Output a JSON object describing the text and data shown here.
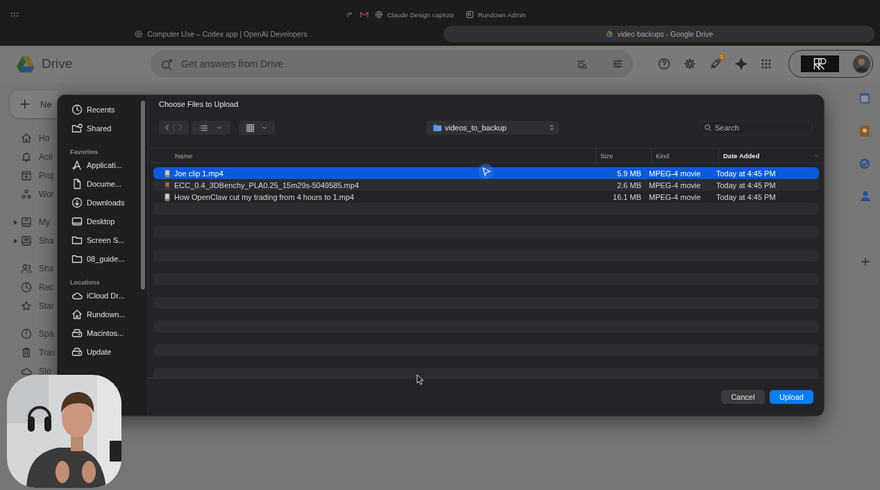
{
  "browser": {
    "bookmarks": [
      {
        "label": "Claude Design capture"
      },
      {
        "label": "Rundown Admin"
      }
    ],
    "tabs": [
      {
        "title": "Computer Use – Codex app | OpenAI Developers",
        "selected": false
      },
      {
        "title": "video backups - Google Drive",
        "selected": true
      }
    ]
  },
  "drive": {
    "app_name": "Drive",
    "search": {
      "placeholder": "Get answers from Drive"
    },
    "notification_count": "1",
    "new_button": "Ne",
    "nav": [
      {
        "label": "Ho",
        "kind": "home",
        "expandable": false
      },
      {
        "label": "Acti",
        "kind": "bell",
        "expandable": false
      },
      {
        "label": "Proj",
        "kind": "project",
        "expandable": false
      },
      {
        "label": "Wor",
        "kind": "workspace",
        "expandable": false
      },
      {
        "label": "My",
        "kind": "drive",
        "expandable": true
      },
      {
        "label": "Sha",
        "kind": "shared-drive",
        "expandable": true
      },
      {
        "label": "Sha",
        "kind": "people",
        "expandable": false
      },
      {
        "label": "Rec",
        "kind": "clock",
        "expandable": false
      },
      {
        "label": "Star",
        "kind": "star",
        "expandable": false
      },
      {
        "label": "Spa",
        "kind": "alert",
        "expandable": false
      },
      {
        "label": "Tras",
        "kind": "trash",
        "expandable": false
      },
      {
        "label": "Sto",
        "kind": "cloud",
        "expandable": false
      }
    ]
  },
  "dialog": {
    "title": "Choose Files to Upload",
    "folder": "videos_to_backup",
    "search": {
      "placeholder": "Search"
    },
    "sidebar": [
      {
        "items": [
          {
            "label": "Recents",
            "kind": "clock"
          },
          {
            "label": "Shared",
            "kind": "shared-folder"
          }
        ]
      },
      {
        "heading": "Favorites",
        "items": [
          {
            "label": "Applicati...",
            "kind": "apps"
          },
          {
            "label": "Docume...",
            "kind": "document"
          },
          {
            "label": "Downloads",
            "kind": "download"
          },
          {
            "label": "Desktop",
            "kind": "desktop"
          },
          {
            "label": "Screen S...",
            "kind": "folder"
          },
          {
            "label": "08_guide...",
            "kind": "folder"
          }
        ]
      },
      {
        "heading": "Locations",
        "items": [
          {
            "label": "iCloud Dr...",
            "kind": "cloud"
          },
          {
            "label": "Rundown...",
            "kind": "home"
          },
          {
            "label": "Macintos...",
            "kind": "disk"
          },
          {
            "label": "Update",
            "kind": "disk"
          }
        ]
      }
    ],
    "columns": [
      {
        "label": "Name",
        "sorted": false
      },
      {
        "label": "Size",
        "sorted": false
      },
      {
        "label": "Kind",
        "sorted": false
      },
      {
        "label": "Date Added",
        "sorted": true
      }
    ],
    "rows": [
      {
        "name": "Joe clip 1.mp4",
        "size": "5.9 MB",
        "kind": "MPEG-4 movie",
        "date": "Today at 4:45 PM",
        "selected": true
      },
      {
        "name": "ECC_0.4_3DBenchy_PLA0.25_15m29s-5049585.mp4",
        "size": "2.6 MB",
        "kind": "MPEG-4 movie",
        "date": "Today at 4:45 PM",
        "selected": false
      },
      {
        "name": "How OpenClaw cut my trading from 4 hours to 1.mp4",
        "size": "16.1 MB",
        "kind": "MPEG-4 movie",
        "date": "Today at 4:45 PM",
        "selected": false
      }
    ],
    "buttons": {
      "cancel": "Cancel",
      "upload": "Upload"
    }
  }
}
